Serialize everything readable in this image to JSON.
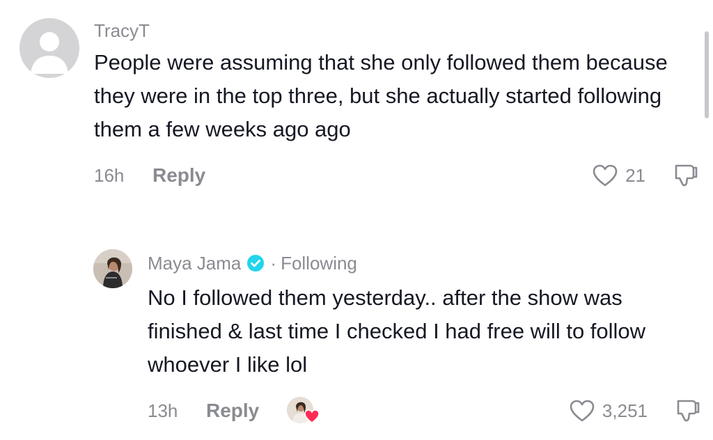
{
  "comments": [
    {
      "username": "TracyT",
      "text": "People were assuming that she only followed them because they were in the top three, but she actually started following them a few weeks ago ago",
      "time": "16h",
      "reply_label": "Reply",
      "likes": "21"
    },
    {
      "username": "Maya Jama",
      "verified": true,
      "separator": "·",
      "follow_status": "Following",
      "text": "No I followed them yesterday.. after the show was finished & last time I checked I had free will to follow whoever I like lol",
      "time": "13h",
      "reply_label": "Reply",
      "likes": "3,251",
      "liked_by_creator": true
    }
  ],
  "colors": {
    "primary_text": "#161823",
    "secondary_text": "#8a8b91",
    "verified": "#20d5ec",
    "heart": "#fe2c55"
  },
  "icons": [
    "default-avatar-icon",
    "verified-badge-icon",
    "heart-outline-icon",
    "dislike-icon",
    "creator-heart-icon"
  ]
}
